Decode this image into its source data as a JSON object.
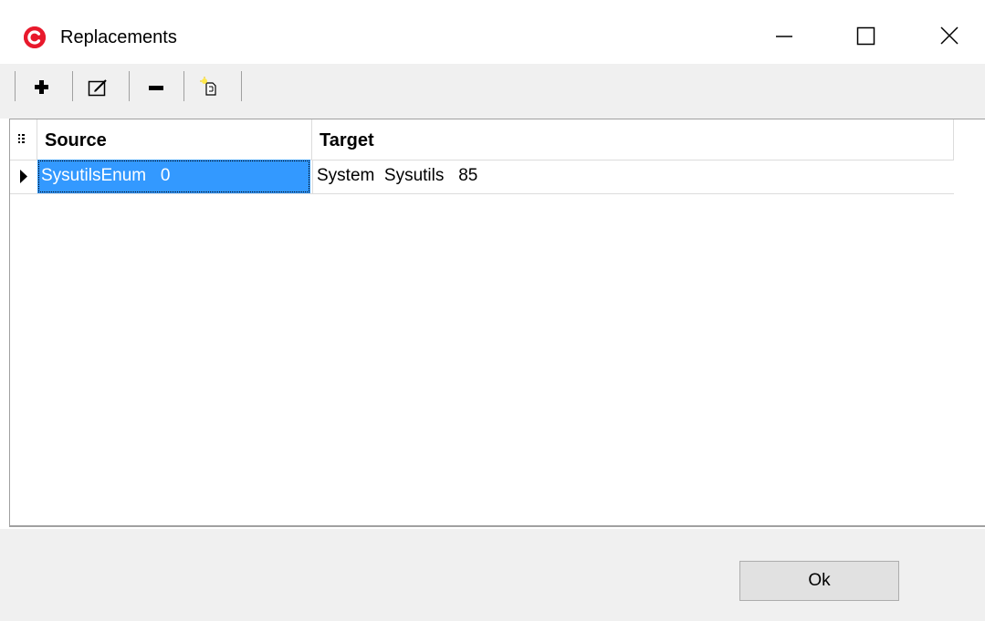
{
  "window": {
    "title": "Replacements",
    "icon": "app-logo-icon",
    "accent_color": "#e8192c"
  },
  "toolbar": {
    "buttons": [
      {
        "name": "add-icon"
      },
      {
        "name": "edit-icon"
      },
      {
        "name": "remove-icon"
      },
      {
        "name": "new-document-icon"
      }
    ]
  },
  "grid": {
    "columns": [
      "Source",
      "Target"
    ],
    "rows": [
      {
        "source": "SysutilsEnum   0",
        "target": "System  Sysutils   85",
        "selected": true
      }
    ],
    "selection_color": "#3399ff"
  },
  "footer": {
    "ok_label": "Ok"
  }
}
